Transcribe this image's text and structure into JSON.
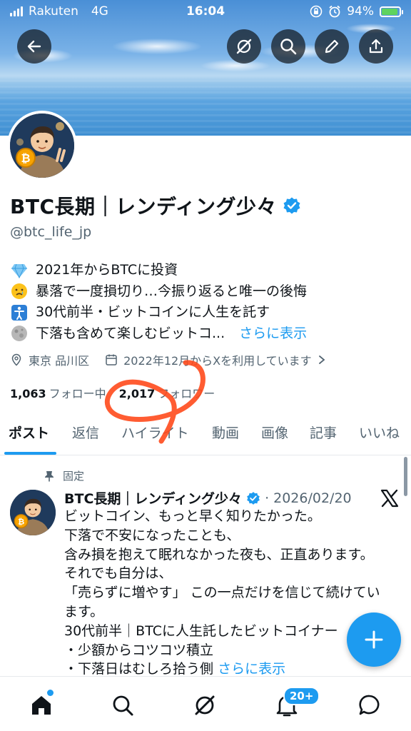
{
  "status_bar": {
    "carrier": "Rakuten",
    "network": "4G",
    "time": "16:04",
    "battery": "94%"
  },
  "header_actions": [
    {
      "name": "back-button",
      "icon": "arrow-left-icon"
    },
    {
      "name": "grok-button",
      "icon": "grok-icon"
    },
    {
      "name": "search-button",
      "icon": "search-icon"
    },
    {
      "name": "edit-button",
      "icon": "pencil-icon"
    },
    {
      "name": "share-button",
      "icon": "share-icon"
    }
  ],
  "profile": {
    "display_name": "BTC長期｜レンディング少々",
    "verified": true,
    "handle": "@btc_life_jp",
    "bio": [
      {
        "emoji": "gem-icon",
        "text": "2021年からBTCに投資"
      },
      {
        "emoji": "crying-face-icon",
        "text": "暴落で一度損切り…今振り返ると唯一の後悔"
      },
      {
        "emoji": "person-icon",
        "text": "30代前半・ビットコインに人生を託す"
      },
      {
        "emoji": "moon-icon",
        "text": "下落も含めて楽しむビットコ..."
      }
    ],
    "bio_more": "さらに表示",
    "location": "東京 品川区",
    "joined": "2022年12月からXを利用しています",
    "following_count": "1,063",
    "following_label": "フォロー中",
    "followers_count": "2,017",
    "followers_label": "フォロワー"
  },
  "tabs": [
    {
      "label": "ポスト",
      "active": true
    },
    {
      "label": "返信",
      "active": false
    },
    {
      "label": "ハイライト",
      "active": false
    },
    {
      "label": "動画",
      "active": false
    },
    {
      "label": "画像",
      "active": false
    },
    {
      "label": "記事",
      "active": false
    },
    {
      "label": "いいね",
      "active": false
    }
  ],
  "pinned_post": {
    "pinned_label": "固定",
    "author": "BTC長期｜レンディング少々",
    "separator": "·",
    "date": "2026/02/20",
    "lines": [
      "ビットコイン、もっと早く知りたかった。",
      "下落で不安になったことも、",
      "含み損を抱えて眠れなかった夜も、正直あります。",
      "それでも自分は、",
      "「売らずに増やす」 この一点だけを信じて続けてい",
      "ます。",
      "30代前半｜BTCに人生託したビットコイナー",
      "・少額からコツコツ積立",
      "・下落日はむしろ拾う側"
    ],
    "more": "さらに表示"
  },
  "bottom_nav": {
    "items": [
      "home-icon",
      "search-icon",
      "grok-icon",
      "bell-icon",
      "messages-icon"
    ],
    "notification_badge": "20+"
  },
  "colors": {
    "accent": "#1d9bf0",
    "text": "#0f1419",
    "muted": "#536471",
    "annotation": "#ff4a1c"
  }
}
